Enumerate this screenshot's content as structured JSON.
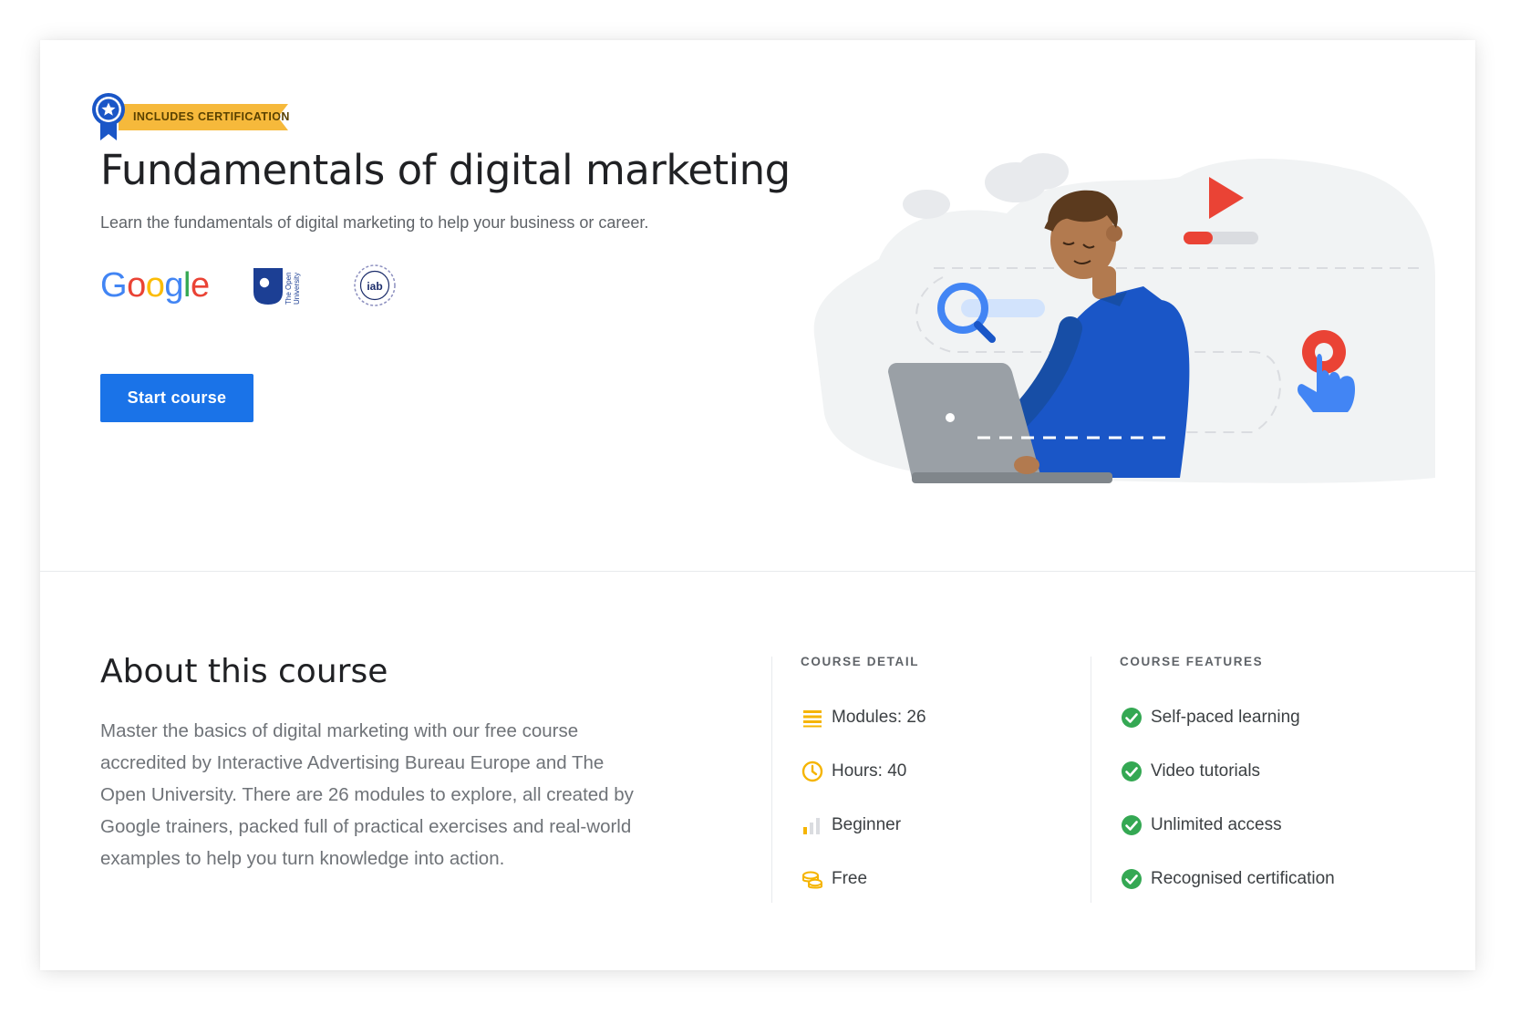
{
  "badge": {
    "label": "INCLUDES CERTIFICATION",
    "icon": "award-ribbon-icon"
  },
  "course": {
    "title": "Fundamentals of digital marketing",
    "subtitle": "Learn the fundamentals of digital marketing to help your business or career."
  },
  "partners": {
    "google": "Google",
    "open_university_lines": [
      "The Open",
      "University"
    ],
    "iab": "iab"
  },
  "actions": {
    "start_label": "Start course"
  },
  "about": {
    "heading": "About this course",
    "description": "Master the basics of digital marketing with our free course accredited by Interactive Advertising Bureau Europe and The Open University. There are 26 modules to explore, all created by Google trainers, packed full of practical exercises and real-world examples to help you turn knowledge into action."
  },
  "details": {
    "label": "COURSE DETAIL",
    "items": [
      {
        "icon": "modules-list-icon",
        "text": "Modules: 26"
      },
      {
        "icon": "clock-icon",
        "text": "Hours: 40"
      },
      {
        "icon": "level-bars-icon",
        "text": "Beginner"
      },
      {
        "icon": "coins-icon",
        "text": "Free"
      }
    ]
  },
  "features": {
    "label": "COURSE FEATURES",
    "items": [
      {
        "icon": "check-circle-icon",
        "text": "Self-paced learning"
      },
      {
        "icon": "check-circle-icon",
        "text": "Video tutorials"
      },
      {
        "icon": "check-circle-icon",
        "text": "Unlimited access"
      },
      {
        "icon": "check-circle-icon",
        "text": "Recognised certification"
      }
    ]
  },
  "colors": {
    "primary": "#1a73e8",
    "badge_yellow": "#f6b93b",
    "check_green": "#34a853",
    "detail_icon_yellow": "#f5b400",
    "play_red": "#ea4335"
  }
}
